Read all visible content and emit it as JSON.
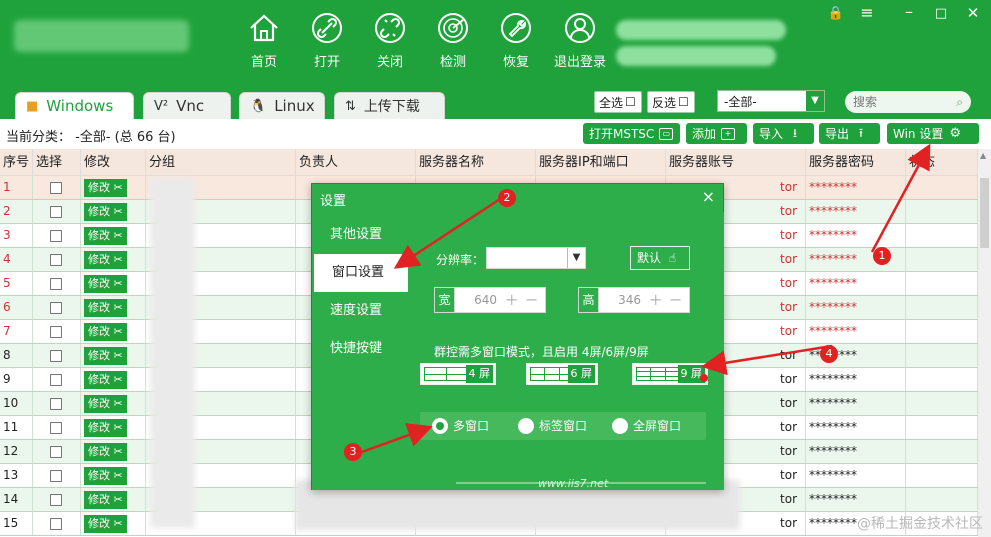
{
  "header": {
    "toolbar": [
      {
        "label": "首页",
        "icon": "home-icon"
      },
      {
        "label": "打开",
        "icon": "link-icon"
      },
      {
        "label": "关闭",
        "icon": "unlink-icon"
      },
      {
        "label": "检测",
        "icon": "radar-icon"
      },
      {
        "label": "恢复",
        "icon": "wrench-icon"
      },
      {
        "label": "退出登录",
        "icon": "user-icon"
      }
    ]
  },
  "tabs": [
    {
      "label": "Windows"
    },
    {
      "label": "Vnc"
    },
    {
      "label": "Linux"
    },
    {
      "label": "上传下载"
    }
  ],
  "filter": {
    "select_all": "全选",
    "invert_select": "反选",
    "group_value": "-全部-",
    "search_placeholder": "搜索"
  },
  "actions": {
    "crumb_label": "当前分类：",
    "crumb_value": "-全部- (总 66 台)",
    "open_mstsc": "打开MSTSC",
    "add": "添加",
    "import": "导入",
    "export": "导出",
    "win_settings": "Win 设置"
  },
  "table": {
    "columns": [
      "序号",
      "选择",
      "修改",
      "分组",
      "负责人",
      "服务器名称",
      "服务器IP和端口",
      "服务器账号",
      "服务器密码",
      "状态"
    ],
    "edit_label": "修改",
    "rows": [
      {
        "no": "1",
        "account": "tor",
        "password": "********"
      },
      {
        "no": "2",
        "account": "tor",
        "password": "********"
      },
      {
        "no": "3",
        "account": "tor",
        "password": "********"
      },
      {
        "no": "4",
        "account": "tor",
        "password": "********"
      },
      {
        "no": "5",
        "account": "tor",
        "password": "********"
      },
      {
        "no": "6",
        "account": "tor",
        "password": "********"
      },
      {
        "no": "7",
        "account": "tor",
        "password": "********"
      },
      {
        "no": "8",
        "account": "tor",
        "password": "********"
      },
      {
        "no": "9",
        "account": "tor",
        "password": "********"
      },
      {
        "no": "10",
        "account": "tor",
        "password": "********"
      },
      {
        "no": "11",
        "account": "tor",
        "password": "********"
      },
      {
        "no": "12",
        "account": "tor",
        "password": "********"
      },
      {
        "no": "13",
        "account": "tor",
        "password": "********"
      },
      {
        "no": "14",
        "account": "tor",
        "password": "********"
      },
      {
        "no": "15",
        "account": "tor",
        "password": "********"
      }
    ]
  },
  "dialog": {
    "title": "设置",
    "close": "×",
    "nav": [
      "其他设置",
      "窗口设置",
      "速度设置",
      "快捷按键"
    ],
    "resolution_label": "分辨率：",
    "default_btn": "默认",
    "width_cap": "宽",
    "width_value": "640",
    "height_cap": "高",
    "height_value": "346",
    "multi_note": "群控需多窗口模式，且启用 4屏/6屏/9屏",
    "screens": [
      "4 屏",
      "6 屏",
      "9 屏"
    ],
    "modes": [
      "多窗口",
      "标签窗口",
      "全屏窗口"
    ],
    "footer": "www.iis7.net"
  },
  "annotations": [
    "1",
    "2",
    "3",
    "4"
  ],
  "watermark": "@稀土掘金技术社区"
}
